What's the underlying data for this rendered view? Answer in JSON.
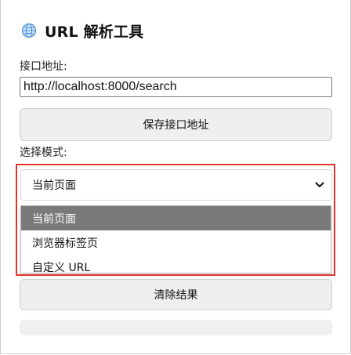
{
  "header": {
    "title": "URL 解析工具",
    "icon": "globe-icon"
  },
  "endpoint": {
    "label": "接口地址:",
    "value": "http://localhost:8000/search",
    "save_label": "保存接口地址"
  },
  "mode": {
    "label": "选择模式:",
    "selected": "当前页面",
    "options": [
      "当前页面",
      "浏览器标签页",
      "自定义 URL"
    ]
  },
  "actions": {
    "clear_label": "清除结果"
  },
  "colors": {
    "highlight": "#e0342b",
    "selected_option_bg": "#7a7a7a"
  }
}
